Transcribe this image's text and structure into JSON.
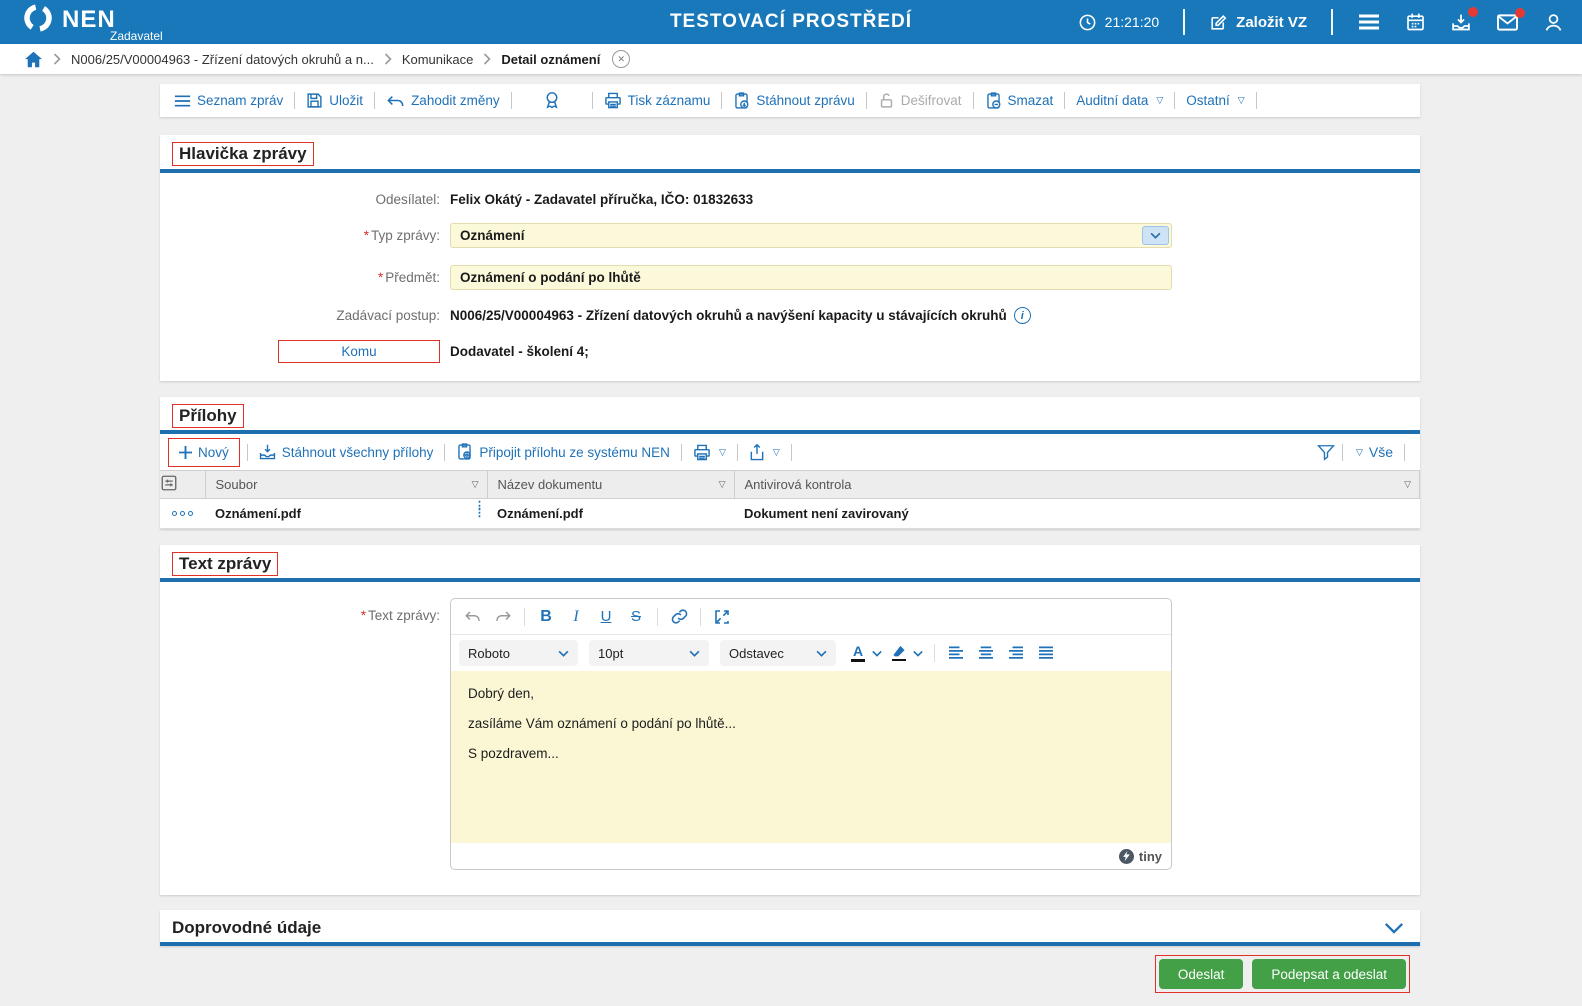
{
  "glyphs": {
    "dropdown": "▽",
    "required": "*",
    "bold": "B",
    "italic": "I",
    "underline": "U",
    "strike": "S",
    "color_letter": "A",
    "info": "i",
    "close": "✕",
    "col_handle": "⋮⋮"
  },
  "header": {
    "brand": "NEN",
    "brand_sub": "Zadavatel",
    "environment": "TESTOVACÍ PROSTŘEDÍ",
    "time": "21:21:20",
    "create_vz_label": "Založit VZ"
  },
  "breadcrumb": {
    "items": [
      "N006/25/V00004963 - Zřízení datových okruhů a n...",
      "Komunikace",
      "Detail oznámení"
    ]
  },
  "toolbar": {
    "seznam_zprav": "Seznam zpráv",
    "ulozit": "Uložit",
    "zahodit_zmeny": "Zahodit změny",
    "tisk_zaznamu": "Tisk záznamu",
    "stahnout_zpravu": "Stáhnout zprávu",
    "desifrovat": "Dešifrovat",
    "smazat": "Smazat",
    "auditni_data": "Auditní data",
    "ostatni": "Ostatní"
  },
  "message_header": {
    "title": "Hlavička zprávy",
    "sender_label": "Odesílatel:",
    "sender_value": "Felix Okátý - Zadavatel příručka, IČO: 01832633",
    "type_label": "Typ zprávy:",
    "type_value": "Oznámení",
    "subject_label": "Předmět:",
    "subject_value": "Oznámení o podání po lhůtě",
    "procedure_label": "Zadávací postup:",
    "procedure_value": "N006/25/V00004963 - Zřízení datových okruhů a navýšení kapacity u stávajících okruhů",
    "to_label": "Komu",
    "to_value": "Dodavatel - školení 4;"
  },
  "attachments": {
    "title": "Přílohy",
    "new_label": "Nový",
    "download_all_label": "Stáhnout všechny přílohy",
    "attach_from_nen_label": "Připojit přílohu ze systému NEN",
    "filter_all_label": "Vše",
    "columns": [
      "Soubor",
      "Název dokumentu",
      "Antivirová kontrola"
    ],
    "rows": [
      {
        "soubor": "Oznámení.pdf",
        "nazev_dokumentu": "Oznámení.pdf",
        "antivirova_kontrola": "Dokument není zavirovaný"
      }
    ]
  },
  "message_text": {
    "title": "Text zprávy",
    "label": "Text zprávy:",
    "editor": {
      "font_name": "Roboto",
      "font_size": "10pt",
      "block_format": "Odstavec",
      "paragraphs": [
        "Dobrý den,",
        "zasíláme Vám oznámení o podání po lhůtě...",
        "S pozdravem..."
      ],
      "brand": "tiny"
    }
  },
  "additional_info": {
    "title": "Doprovodné údaje"
  },
  "actions": {
    "send": "Odeslat",
    "sign_and_send": "Podepsat a odeslat"
  },
  "colors": {
    "header_blue": "#1878BA",
    "accent_blue": "#2072B8",
    "rule_blue": "#1E6FAD",
    "field_yellow": "#FCF8DA",
    "annotation_red": "#E03126",
    "button_green": "#43A047",
    "badge_red": "#E53935"
  }
}
